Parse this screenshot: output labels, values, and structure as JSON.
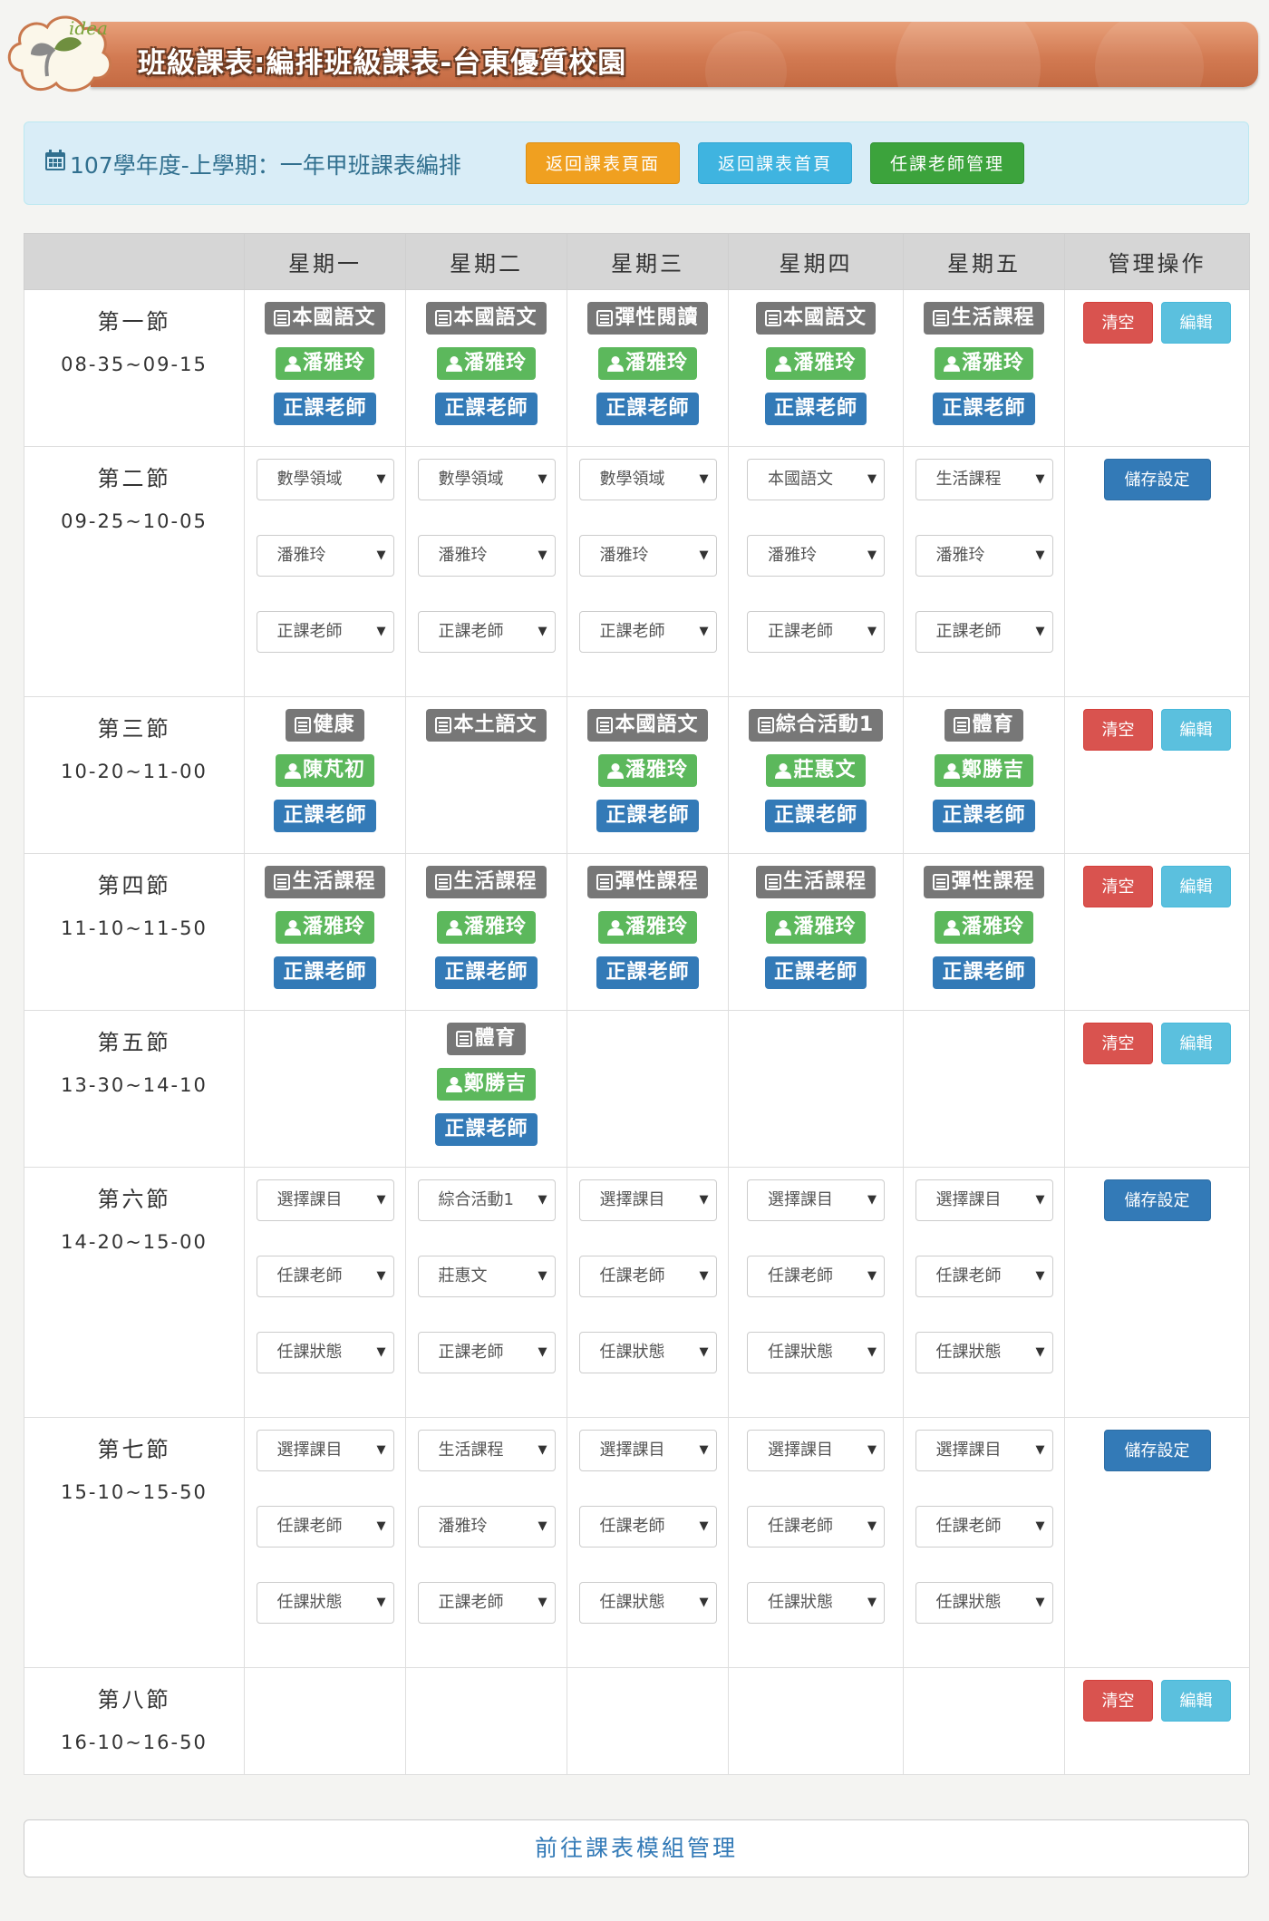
{
  "header": {
    "logo_text": "idea",
    "title": "班級課表:編排班級課表-台東優質校園"
  },
  "info": {
    "text": "107學年度-上學期：一年甲班課表編排",
    "buttons": {
      "back_list": "返回課表頁面",
      "back_home": "返回課表首頁",
      "teacher_mgmt": "任課老師管理"
    }
  },
  "table": {
    "headers": [
      "",
      "星期一",
      "星期二",
      "星期三",
      "星期四",
      "星期五",
      "管理操作"
    ],
    "periods": [
      {
        "name": "第一節",
        "time": "08-35~09-15",
        "mode": "view",
        "cells": [
          {
            "subject": "本國語文",
            "teacher": "潘雅玲",
            "status": "正課老師"
          },
          {
            "subject": "本國語文",
            "teacher": "潘雅玲",
            "status": "正課老師"
          },
          {
            "subject": "彈性閱讀",
            "teacher": "潘雅玲",
            "status": "正課老師"
          },
          {
            "subject": "本國語文",
            "teacher": "潘雅玲",
            "status": "正課老師"
          },
          {
            "subject": "生活課程",
            "teacher": "潘雅玲",
            "status": "正課老師"
          }
        ]
      },
      {
        "name": "第二節",
        "time": "09-25~10-05",
        "mode": "edit",
        "cells": [
          {
            "subject": "數學領域",
            "teacher": "潘雅玲",
            "status": "正課老師"
          },
          {
            "subject": "數學領域",
            "teacher": "潘雅玲",
            "status": "正課老師"
          },
          {
            "subject": "數學領域",
            "teacher": "潘雅玲",
            "status": "正課老師"
          },
          {
            "subject": "本國語文",
            "teacher": "潘雅玲",
            "status": "正課老師"
          },
          {
            "subject": "生活課程",
            "teacher": "潘雅玲",
            "status": "正課老師"
          }
        ]
      },
      {
        "name": "第三節",
        "time": "10-20~11-00",
        "mode": "view",
        "cells": [
          {
            "subject": "健康",
            "teacher": "陳芃初",
            "status": "正課老師"
          },
          {
            "subject": "本土語文",
            "teacher": "",
            "status": ""
          },
          {
            "subject": "本國語文",
            "teacher": "潘雅玲",
            "status": "正課老師"
          },
          {
            "subject": "綜合活動1",
            "teacher": "莊惠文",
            "status": "正課老師"
          },
          {
            "subject": "體育",
            "teacher": "鄭勝吉",
            "status": "正課老師"
          }
        ]
      },
      {
        "name": "第四節",
        "time": "11-10~11-50",
        "mode": "view",
        "cells": [
          {
            "subject": "生活課程",
            "teacher": "潘雅玲",
            "status": "正課老師"
          },
          {
            "subject": "生活課程",
            "teacher": "潘雅玲",
            "status": "正課老師"
          },
          {
            "subject": "彈性課程",
            "teacher": "潘雅玲",
            "status": "正課老師"
          },
          {
            "subject": "生活課程",
            "teacher": "潘雅玲",
            "status": "正課老師"
          },
          {
            "subject": "彈性課程",
            "teacher": "潘雅玲",
            "status": "正課老師"
          }
        ]
      },
      {
        "name": "第五節",
        "time": "13-30~14-10",
        "mode": "view",
        "cells": [
          null,
          {
            "subject": "體育",
            "teacher": "鄭勝吉",
            "status": "正課老師"
          },
          null,
          null,
          null
        ]
      },
      {
        "name": "第六節",
        "time": "14-20~15-00",
        "mode": "edit",
        "cells": [
          {
            "subject": "選擇課目",
            "teacher": "任課老師",
            "status": "任課狀態"
          },
          {
            "subject": "綜合活動1",
            "teacher": "莊惠文",
            "status": "正課老師"
          },
          {
            "subject": "選擇課目",
            "teacher": "任課老師",
            "status": "任課狀態"
          },
          {
            "subject": "選擇課目",
            "teacher": "任課老師",
            "status": "任課狀態"
          },
          {
            "subject": "選擇課目",
            "teacher": "任課老師",
            "status": "任課狀態"
          }
        ]
      },
      {
        "name": "第七節",
        "time": "15-10~15-50",
        "mode": "edit",
        "cells": [
          {
            "subject": "選擇課目",
            "teacher": "任課老師",
            "status": "任課狀態"
          },
          {
            "subject": "生活課程",
            "teacher": "潘雅玲",
            "status": "正課老師"
          },
          {
            "subject": "選擇課目",
            "teacher": "任課老師",
            "status": "任課狀態"
          },
          {
            "subject": "選擇課目",
            "teacher": "任課老師",
            "status": "任課狀態"
          },
          {
            "subject": "選擇課目",
            "teacher": "任課老師",
            "status": "任課狀態"
          }
        ]
      },
      {
        "name": "第八節",
        "time": "16-10~16-50",
        "mode": "view",
        "cells": [
          null,
          null,
          null,
          null,
          null
        ]
      }
    ],
    "actions": {
      "clear": "清空",
      "edit": "編輯",
      "save": "儲存設定"
    }
  },
  "footer": {
    "module_button": "前往課表模組管理"
  },
  "colors": {
    "subject_label": "#777777",
    "teacher_label": "#5cb85c",
    "status_label": "#337ab7",
    "clear_btn": "#d9534f",
    "edit_btn": "#5bc0de",
    "save_btn": "#337ab7"
  }
}
